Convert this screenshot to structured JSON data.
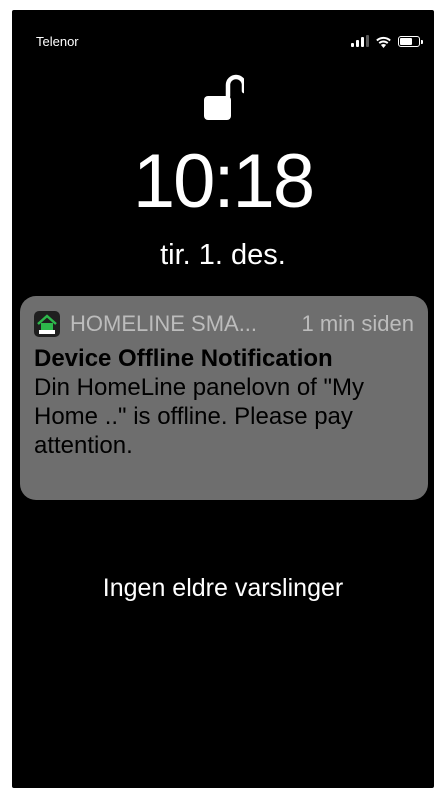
{
  "status_bar": {
    "carrier": "Telenor",
    "signal_bars": 3,
    "battery_level": 0.7
  },
  "lock_screen": {
    "lock_state": "unlocked",
    "lock_icon": "unlocked-padlock-icon",
    "time": "10:18",
    "date": "tir. 1. des."
  },
  "notification": {
    "app_icon": "homeline-smart-app-icon",
    "app_name": "HOMELINE SMA...",
    "time_ago": "1 min siden",
    "title": "Device Offline Notification",
    "body": "Din HomeLine panelovn of \"My Home ..\" is offline. Please pay attention.",
    "accent_color": "#2db84b"
  },
  "footer": {
    "no_older_notifications": "Ingen eldre varslinger"
  }
}
